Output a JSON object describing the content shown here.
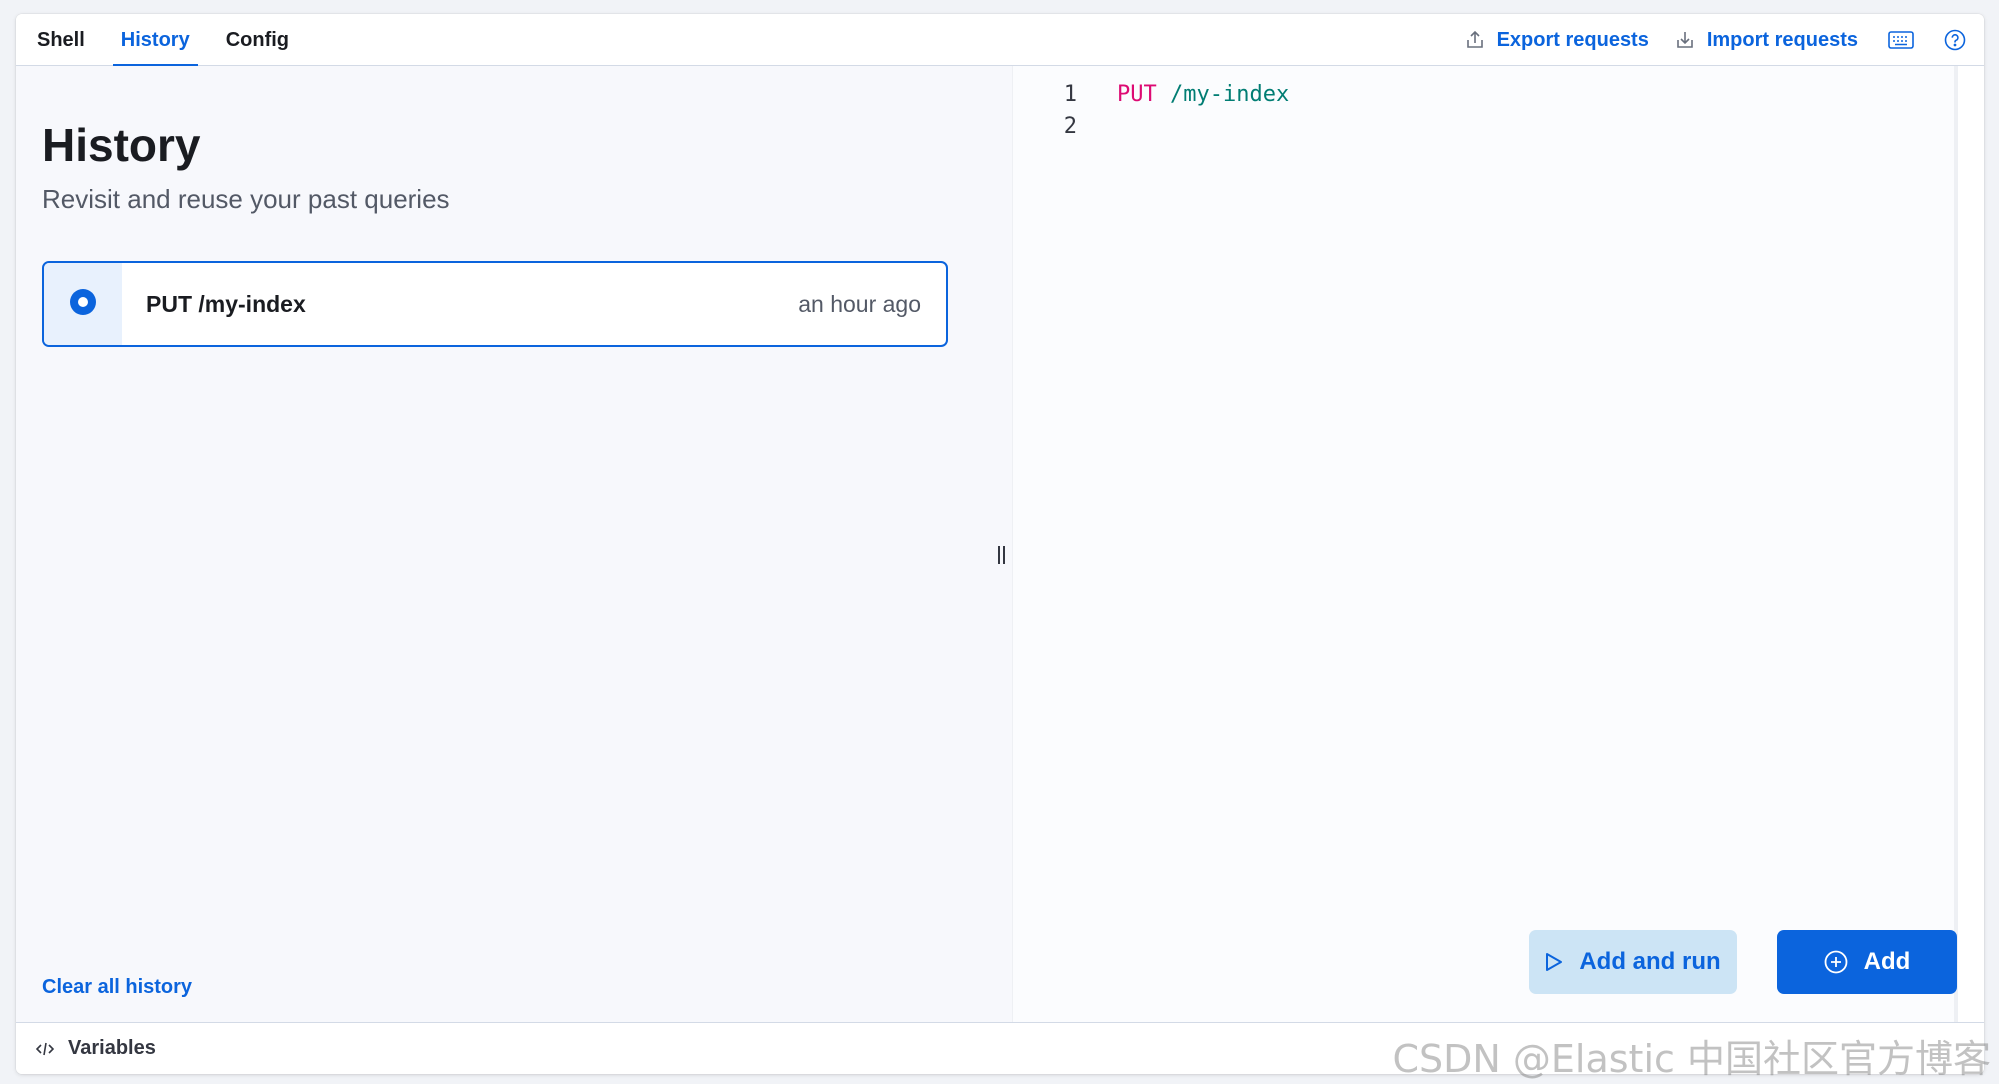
{
  "tabs": [
    {
      "label": "Shell",
      "active": false
    },
    {
      "label": "History",
      "active": true
    },
    {
      "label": "Config",
      "active": false
    }
  ],
  "toolbar": {
    "export_label": "Export requests",
    "import_label": "Import requests",
    "keyboard_icon": "keyboard-icon",
    "help_icon": "help-icon"
  },
  "history": {
    "title": "History",
    "subtitle": "Revisit and reuse your past queries",
    "items": [
      {
        "query": "PUT /my-index",
        "time": "an hour ago",
        "selected": true
      }
    ],
    "clear_label": "Clear all history"
  },
  "editor": {
    "lines": [
      {
        "number": "1",
        "method": "PUT",
        "path": "/my-index"
      },
      {
        "number": "2",
        "method": "",
        "path": ""
      }
    ]
  },
  "actions": {
    "add_and_run_label": "Add and run",
    "add_label": "Add"
  },
  "footer": {
    "variables_label": "Variables"
  },
  "watermark": "CSDN @Elastic 中国社区官方博客",
  "colors": {
    "accent": "#0b64dd",
    "method": "#dd0a73",
    "path": "#017d73"
  }
}
